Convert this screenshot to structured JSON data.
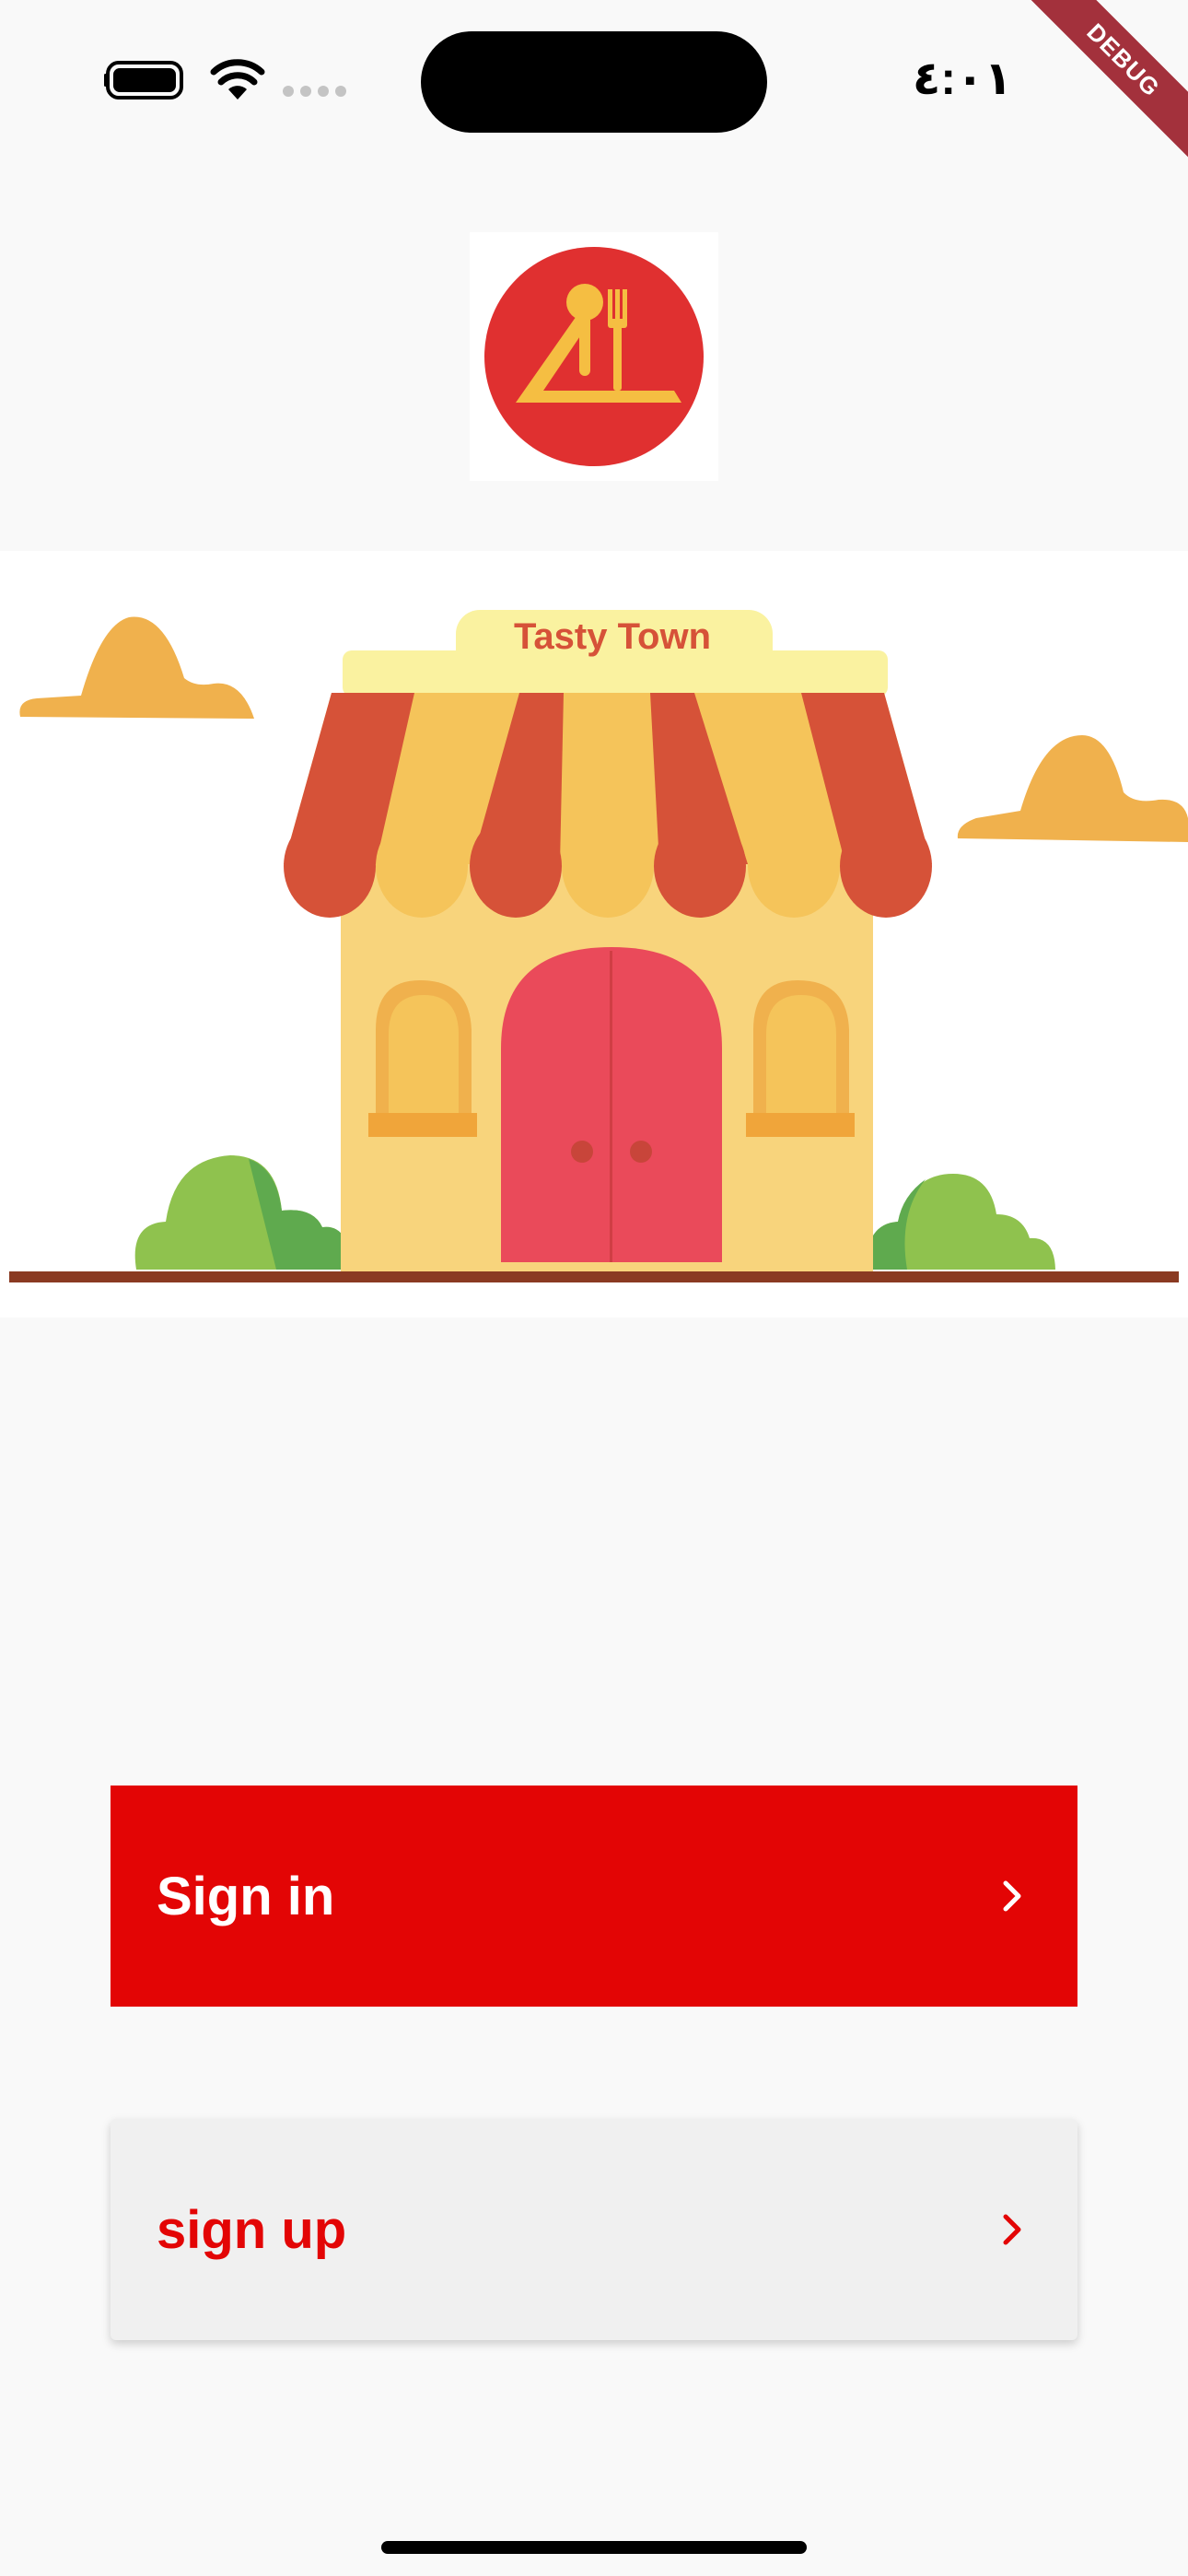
{
  "status_bar": {
    "time": "٤:٠١",
    "debug_banner": "DEBUG",
    "icons": [
      "battery-icon",
      "wifi-icon",
      "cellular-signal-icon"
    ]
  },
  "logo": {
    "icon": "cutlery-logo-icon",
    "colors": {
      "circle": "#e03030",
      "utensils": "#f5be42"
    }
  },
  "illustration": {
    "shop_sign": "Tasty Town",
    "colors": {
      "awning_red": "#d65238",
      "awning_yellow": "#f5c45a",
      "door": "#ea4a5a",
      "wall": "#f8d47c",
      "cloud": "#f0b14d",
      "bush": "#8fc24e"
    }
  },
  "actions": {
    "sign_in_label": "Sign in",
    "sign_up_label": "sign up"
  },
  "colors": {
    "primary": "#e30505",
    "background": "#f9f9f9",
    "secondary_button": "#f0f0f0"
  }
}
